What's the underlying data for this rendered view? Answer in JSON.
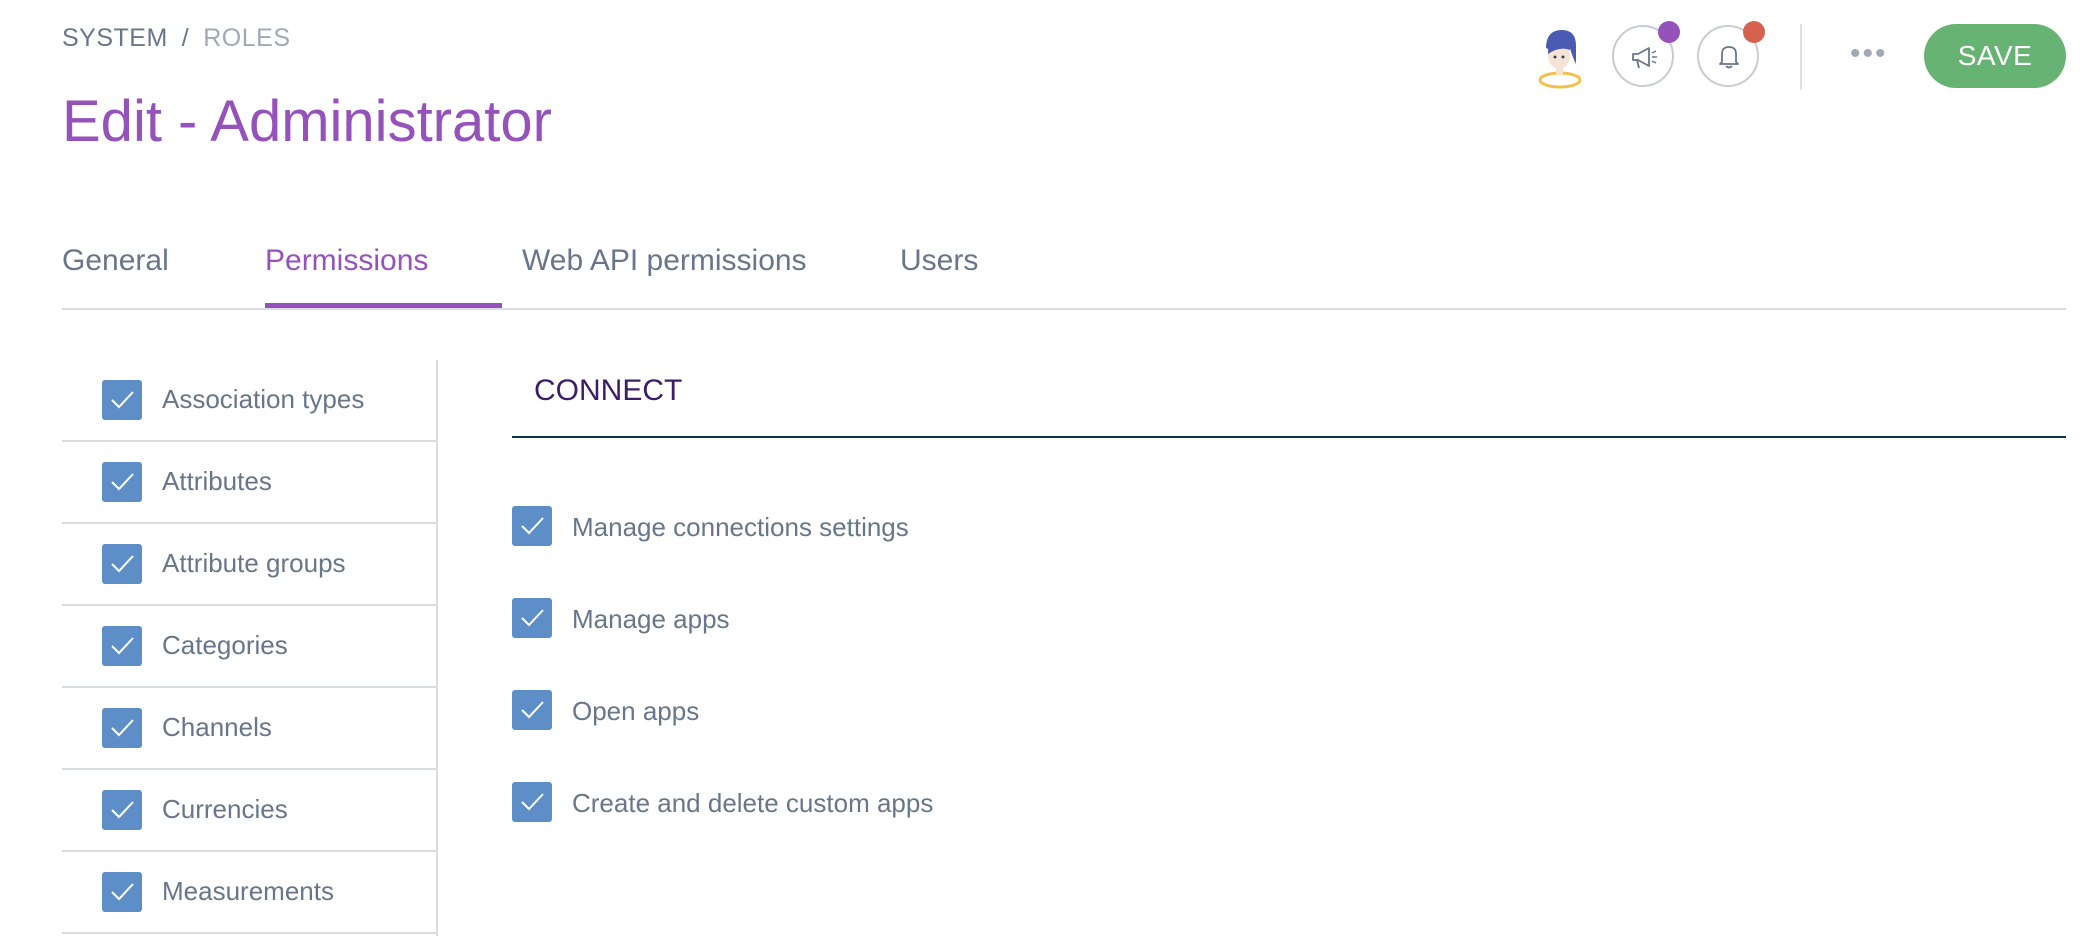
{
  "breadcrumb": {
    "system": "SYSTEM",
    "separator": "/",
    "current": "ROLES"
  },
  "page": {
    "title": "Edit - Administrator"
  },
  "header": {
    "avatar_icon": "user-avatar-icon",
    "announcements_icon": "megaphone-icon",
    "notifications_icon": "bell-icon",
    "more_label": "•••",
    "save_label": "SAVE",
    "colors": {
      "save": "#67b373",
      "announcement_dot": "#9452ba",
      "notification_dot": "#d4624e"
    }
  },
  "tabs": [
    {
      "label": "General",
      "active": false
    },
    {
      "label": "Permissions",
      "active": true
    },
    {
      "label": "Web API permissions",
      "active": false
    },
    {
      "label": "Users",
      "active": false
    }
  ],
  "sidebar": {
    "items": [
      {
        "label": "Association types",
        "checked": true
      },
      {
        "label": "Attributes",
        "checked": true
      },
      {
        "label": "Attribute groups",
        "checked": true
      },
      {
        "label": "Categories",
        "checked": true
      },
      {
        "label": "Channels",
        "checked": true
      },
      {
        "label": "Currencies",
        "checked": true
      },
      {
        "label": "Measurements",
        "checked": true
      }
    ]
  },
  "section": {
    "title": "CONNECT",
    "permissions": [
      {
        "label": "Manage connections settings",
        "checked": true
      },
      {
        "label": "Manage apps",
        "checked": true
      },
      {
        "label": "Open apps",
        "checked": true
      },
      {
        "label": "Create and delete custom apps",
        "checked": true
      }
    ]
  },
  "theme": {
    "accent": "#9452ba",
    "checkbox": "#5e8ec7",
    "text": "#67768a"
  }
}
